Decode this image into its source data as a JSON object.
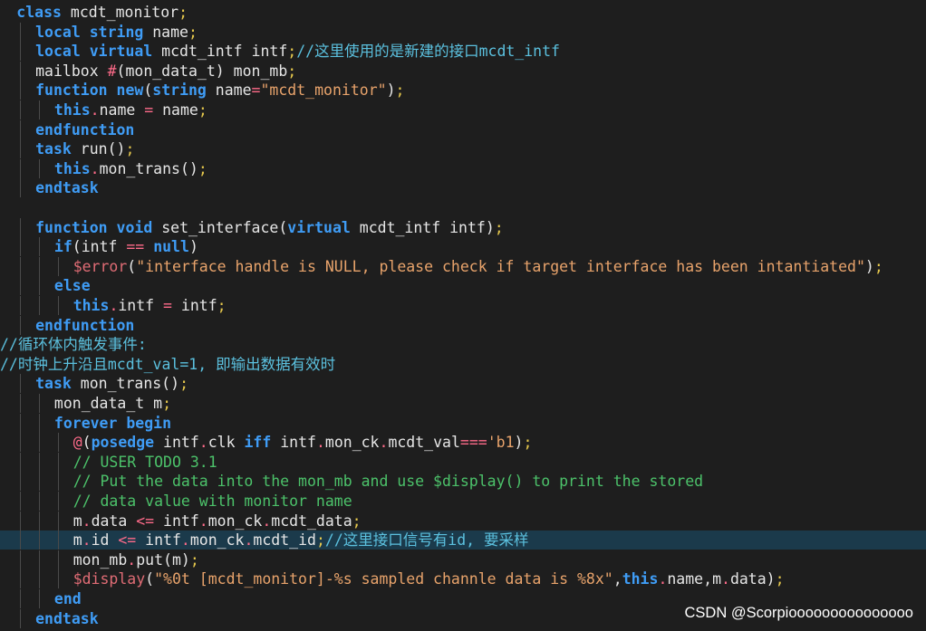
{
  "colors": {
    "background": "#1e1e1e",
    "keyword": "#3f9cf5",
    "identifier": "#e6e6e6",
    "punctuation": "#e6c84c",
    "comment": "#4cc26a",
    "string": "#e8a36b",
    "system_task": "#e06c75",
    "operator": "#ff6b8a",
    "cn_comment": "#5bc0de",
    "highlight_line": "#1b3a4b"
  },
  "code": {
    "lines": [
      {
        "indent": 1,
        "tokens": [
          [
            "kw",
            "class"
          ],
          [
            "id",
            " mcdt_monitor"
          ],
          [
            "p",
            ";"
          ]
        ]
      },
      {
        "indent": 2,
        "tokens": [
          [
            "kw",
            "local"
          ],
          [
            "id",
            " "
          ],
          [
            "kw",
            "string"
          ],
          [
            "id",
            " name"
          ],
          [
            "p",
            ";"
          ]
        ]
      },
      {
        "indent": 2,
        "tokens": [
          [
            "kw",
            "local"
          ],
          [
            "id",
            " "
          ],
          [
            "kw",
            "virtual"
          ],
          [
            "id",
            " mcdt_intf intf"
          ],
          [
            "p",
            ";"
          ],
          [
            "cm",
            "//这里使用的是新建的接口mcdt_intf"
          ]
        ]
      },
      {
        "indent": 2,
        "tokens": [
          [
            "id",
            "mailbox "
          ],
          [
            "op",
            "#"
          ],
          [
            "id",
            "(mon_data_t) mon_mb"
          ],
          [
            "p",
            ";"
          ]
        ]
      },
      {
        "indent": 2,
        "tokens": [
          [
            "kw",
            "function"
          ],
          [
            "id",
            " "
          ],
          [
            "kw",
            "new"
          ],
          [
            "id",
            "("
          ],
          [
            "kw",
            "string"
          ],
          [
            "id",
            " name"
          ],
          [
            "op",
            "="
          ],
          [
            "s",
            "\"mcdt_monitor\""
          ],
          [
            "id",
            ")"
          ],
          [
            "p",
            ";"
          ]
        ]
      },
      {
        "indent": 3,
        "tokens": [
          [
            "kw",
            "this"
          ],
          [
            "op",
            "."
          ],
          [
            "id",
            "name "
          ],
          [
            "op",
            "="
          ],
          [
            "id",
            " name"
          ],
          [
            "p",
            ";"
          ]
        ]
      },
      {
        "indent": 2,
        "tokens": [
          [
            "kw",
            "endfunction"
          ]
        ]
      },
      {
        "indent": 2,
        "tokens": [
          [
            "kw",
            "task"
          ],
          [
            "id",
            " run()"
          ],
          [
            "p",
            ";"
          ]
        ]
      },
      {
        "indent": 3,
        "tokens": [
          [
            "kw",
            "this"
          ],
          [
            "op",
            "."
          ],
          [
            "id",
            "mon_trans()"
          ],
          [
            "p",
            ";"
          ]
        ]
      },
      {
        "indent": 2,
        "tokens": [
          [
            "kw",
            "endtask"
          ]
        ]
      },
      {
        "indent": 1,
        "tokens": []
      },
      {
        "indent": 2,
        "tokens": [
          [
            "kw",
            "function"
          ],
          [
            "id",
            " "
          ],
          [
            "kw",
            "void"
          ],
          [
            "id",
            " set_interface("
          ],
          [
            "kw",
            "virtual"
          ],
          [
            "id",
            " mcdt_intf intf)"
          ],
          [
            "p",
            ";"
          ]
        ]
      },
      {
        "indent": 3,
        "tokens": [
          [
            "kw",
            "if"
          ],
          [
            "id",
            "(intf "
          ],
          [
            "op",
            "=="
          ],
          [
            "id",
            " "
          ],
          [
            "kw",
            "null"
          ],
          [
            "id",
            ")"
          ]
        ]
      },
      {
        "indent": 4,
        "tokens": [
          [
            "sys",
            "$error"
          ],
          [
            "id",
            "("
          ],
          [
            "s",
            "\"interface handle is NULL, please check if target interface has been intantiated\""
          ],
          [
            "id",
            ")"
          ],
          [
            "p",
            ";"
          ]
        ]
      },
      {
        "indent": 3,
        "tokens": [
          [
            "kw",
            "else"
          ]
        ]
      },
      {
        "indent": 4,
        "tokens": [
          [
            "kw",
            "this"
          ],
          [
            "op",
            "."
          ],
          [
            "id",
            "intf "
          ],
          [
            "op",
            "="
          ],
          [
            "id",
            " intf"
          ],
          [
            "p",
            ";"
          ]
        ]
      },
      {
        "indent": 2,
        "tokens": [
          [
            "kw",
            "endfunction"
          ]
        ]
      },
      {
        "indent": 0,
        "tokens": [
          [
            "cm",
            "//循环体内触发事件:"
          ]
        ]
      },
      {
        "indent": 0,
        "tokens": [
          [
            "cm",
            "//时钟上升沿且mcdt_val=1, 即输出数据有效时"
          ]
        ]
      },
      {
        "indent": 2,
        "tokens": [
          [
            "kw",
            "task"
          ],
          [
            "id",
            " mon_trans()"
          ],
          [
            "p",
            ";"
          ]
        ]
      },
      {
        "indent": 3,
        "tokens": [
          [
            "id",
            "mon_data_t m"
          ],
          [
            "p",
            ";"
          ]
        ]
      },
      {
        "indent": 3,
        "tokens": [
          [
            "kw",
            "forever"
          ],
          [
            "id",
            " "
          ],
          [
            "kw",
            "begin"
          ]
        ]
      },
      {
        "indent": 4,
        "tokens": [
          [
            "op",
            "@"
          ],
          [
            "id",
            "("
          ],
          [
            "kw",
            "posedge"
          ],
          [
            "id",
            " intf"
          ],
          [
            "op",
            "."
          ],
          [
            "id",
            "clk "
          ],
          [
            "kw",
            "iff"
          ],
          [
            "id",
            " intf"
          ],
          [
            "op",
            "."
          ],
          [
            "id",
            "mon_ck"
          ],
          [
            "op",
            "."
          ],
          [
            "id",
            "mcdt_val"
          ],
          [
            "op",
            "==="
          ],
          [
            "s",
            "'b1"
          ],
          [
            "id",
            ")"
          ],
          [
            "p",
            ";"
          ]
        ]
      },
      {
        "indent": 4,
        "tokens": [
          [
            "c",
            "// USER TODO 3.1"
          ]
        ]
      },
      {
        "indent": 4,
        "tokens": [
          [
            "c",
            "// Put the data into the mon_mb and use $display() to print the stored"
          ]
        ]
      },
      {
        "indent": 4,
        "tokens": [
          [
            "c",
            "// data value with monitor name"
          ]
        ]
      },
      {
        "indent": 4,
        "tokens": [
          [
            "id",
            "m"
          ],
          [
            "op",
            "."
          ],
          [
            "id",
            "data "
          ],
          [
            "op",
            "<="
          ],
          [
            "id",
            " intf"
          ],
          [
            "op",
            "."
          ],
          [
            "id",
            "mon_ck"
          ],
          [
            "op",
            "."
          ],
          [
            "id",
            "mcdt_data"
          ],
          [
            "p",
            ";"
          ]
        ]
      },
      {
        "indent": 4,
        "hl": true,
        "tokens": [
          [
            "id",
            "m"
          ],
          [
            "op",
            "."
          ],
          [
            "id",
            "id "
          ],
          [
            "op",
            "<="
          ],
          [
            "id",
            " intf"
          ],
          [
            "op",
            "."
          ],
          [
            "id",
            "mon_ck"
          ],
          [
            "op",
            "."
          ],
          [
            "id",
            "mcdt_id"
          ],
          [
            "p",
            ";"
          ],
          [
            "cm",
            "//这里接口信号有id, 要采样"
          ]
        ]
      },
      {
        "indent": 4,
        "tokens": [
          [
            "id",
            "mon_mb"
          ],
          [
            "op",
            "."
          ],
          [
            "id",
            "put(m)"
          ],
          [
            "p",
            ";"
          ]
        ]
      },
      {
        "indent": 4,
        "tokens": [
          [
            "sys",
            "$display"
          ],
          [
            "id",
            "("
          ],
          [
            "s",
            "\"%0t [mcdt_monitor]-%s sampled channle data is %8x\""
          ],
          [
            "id",
            ","
          ],
          [
            "kw",
            "this"
          ],
          [
            "op",
            "."
          ],
          [
            "id",
            "name"
          ],
          [
            "id",
            ","
          ],
          [
            "id",
            "m"
          ],
          [
            "op",
            "."
          ],
          [
            "id",
            "data)"
          ],
          [
            "p",
            ";"
          ]
        ]
      },
      {
        "indent": 3,
        "tokens": [
          [
            "kw",
            "end"
          ]
        ]
      },
      {
        "indent": 2,
        "tokens": [
          [
            "kw",
            "endtask"
          ]
        ]
      }
    ]
  },
  "watermark": "CSDN @Scorpiooooooooooooooo"
}
